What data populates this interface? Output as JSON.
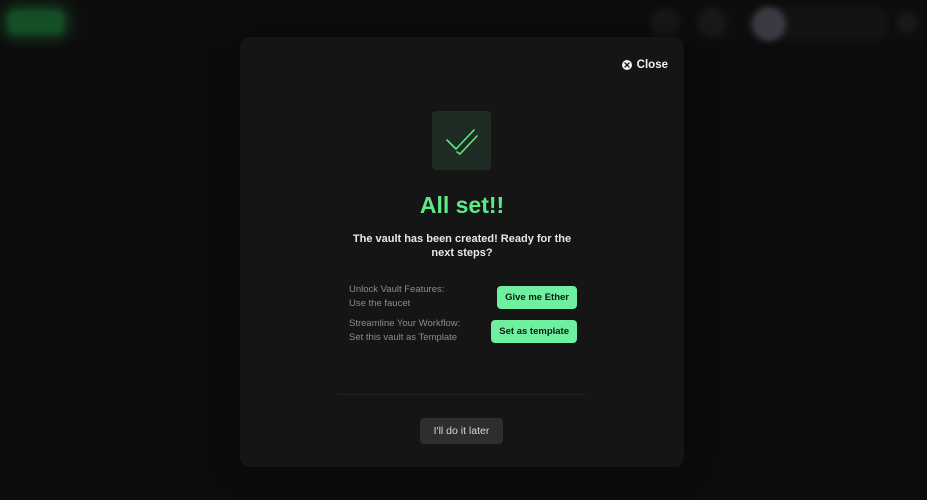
{
  "modal": {
    "close_label": "Close",
    "title": "All set!!",
    "subtitle": "The vault has been created! Ready for the next steps?",
    "steps": [
      {
        "text": "Unlock Vault Features: Use the faucet",
        "button_label": "Give me Ether"
      },
      {
        "text": "Streamline Your Workflow: Set this vault as Template",
        "button_label": "Set as template"
      }
    ],
    "later_label": "I'll do it later"
  },
  "icons": {
    "close": "close-circle-icon",
    "success": "double-check-icon"
  },
  "colors": {
    "accent": "#5de88a",
    "button": "#6ef0a0",
    "background": "#151515"
  }
}
